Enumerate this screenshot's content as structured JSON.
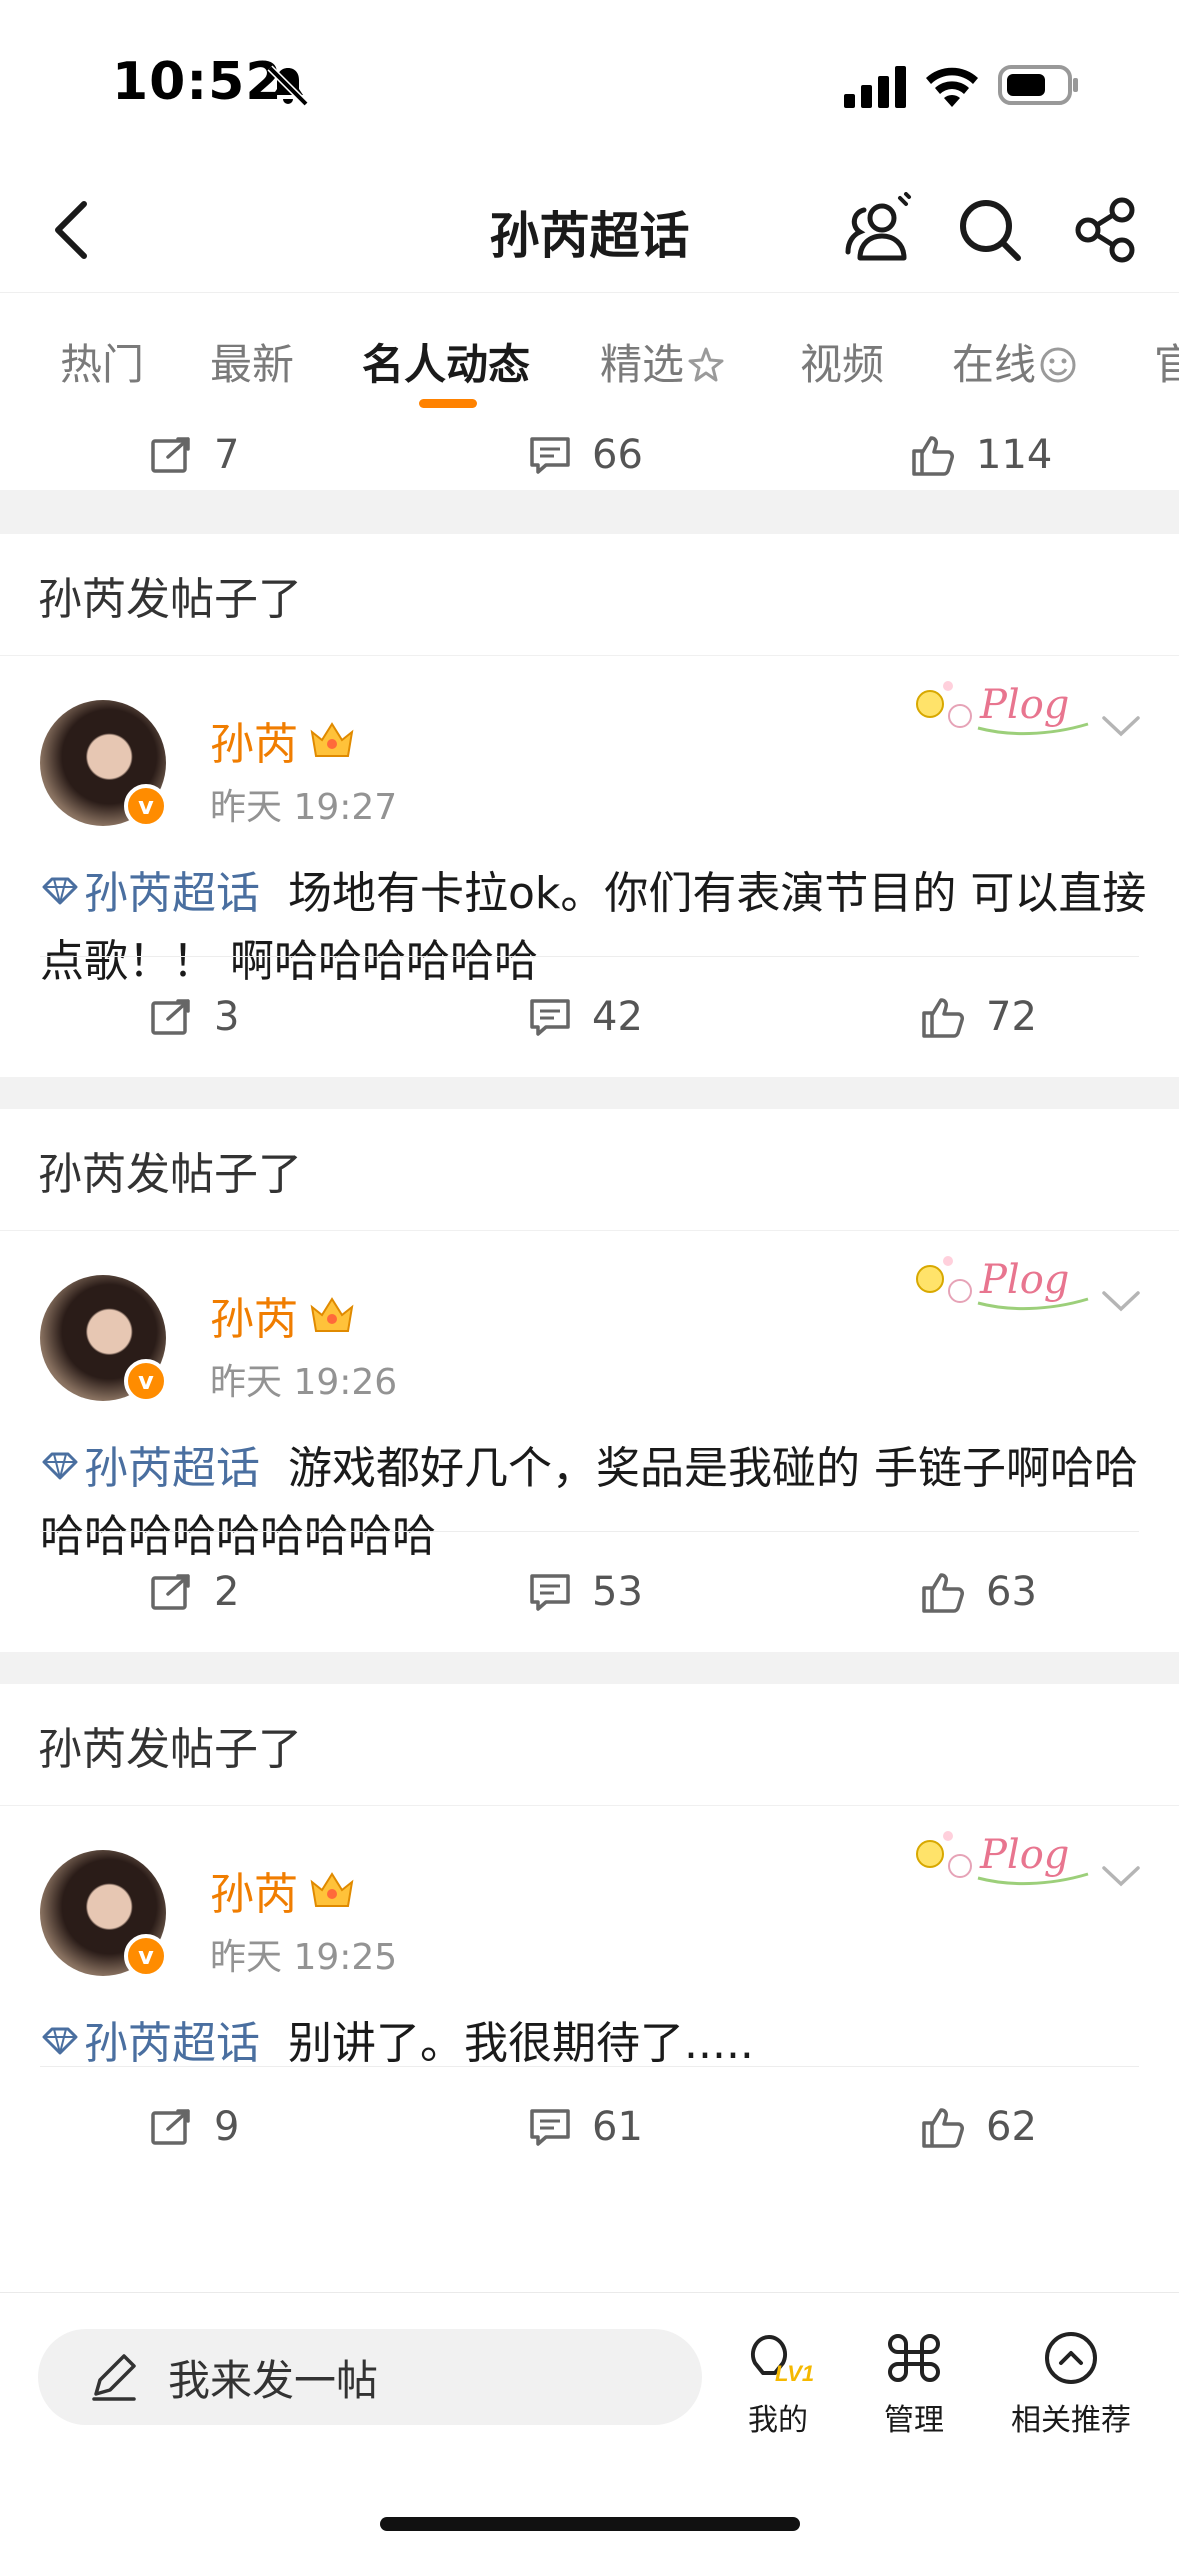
{
  "status_bar": {
    "time": "10:52"
  },
  "header": {
    "title": "孙芮超话"
  },
  "tabs": [
    {
      "label": "热门"
    },
    {
      "label": "最新"
    },
    {
      "label": "名人动态"
    },
    {
      "label": "精选"
    },
    {
      "label": "视频"
    },
    {
      "label": "在线"
    },
    {
      "label": "官"
    }
  ],
  "active_tab": "名人动态",
  "accent_color": "#ff8200",
  "top_actions": {
    "reposts": "7",
    "comments": "66",
    "likes": "114"
  },
  "posts": [
    {
      "section_title": "孙芮发帖子了",
      "author": "孙芮",
      "time": "昨天 19:27",
      "topic": "孙芮超话",
      "text": "场地有卡拉ok。你们有表演节目的 可以直接点歌！！ 啊哈哈哈哈哈哈",
      "reposts": "3",
      "comments": "42",
      "likes": "72"
    },
    {
      "section_title": "孙芮发帖子了",
      "author": "孙芮",
      "time": "昨天 19:26",
      "topic": "孙芮超话",
      "text": "游戏都好几个，奖品是我碰的 手链子啊哈哈哈哈哈哈哈哈哈哈哈",
      "reposts": "2",
      "comments": "53",
      "likes": "63"
    },
    {
      "section_title": "孙芮发帖子了",
      "author": "孙芮",
      "time": "昨天 19:25",
      "topic": "孙芮超话",
      "text": "别讲了。我很期待了.....",
      "reposts": "9",
      "comments": "61",
      "likes": "62"
    }
  ],
  "bottom_bar": {
    "compose_placeholder": "我来发一帖",
    "my": "我的",
    "level_badge": "LV1",
    "manage": "管理",
    "related": "相关推荐"
  },
  "icons": {
    "plog_badge_text": "Plog",
    "verified_badge": "v"
  }
}
